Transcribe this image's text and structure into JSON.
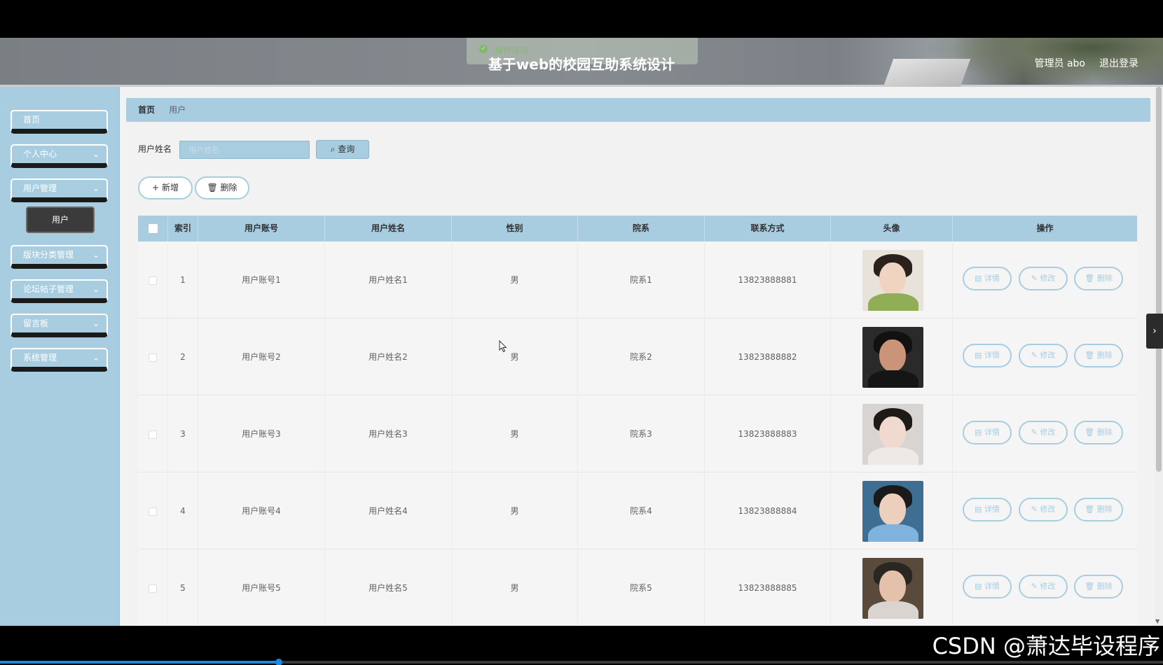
{
  "header": {
    "title": "基于web的校园互助系统设计",
    "toast": "操作成功",
    "user": "管理员 abo",
    "logout": "退出登录"
  },
  "sidebar": {
    "items": [
      {
        "label": "首页",
        "has_arrow": false
      },
      {
        "label": "个人中心",
        "has_arrow": true
      },
      {
        "label": "用户管理",
        "has_arrow": true
      },
      {
        "label": "版块分类管理",
        "has_arrow": true
      },
      {
        "label": "论坛帖子管理",
        "has_arrow": true
      },
      {
        "label": "留言板",
        "has_arrow": true
      },
      {
        "label": "系统管理",
        "has_arrow": true
      }
    ],
    "active_sub": "用户"
  },
  "breadcrumb": {
    "home": "首页",
    "current": "用户"
  },
  "search": {
    "label": "用户姓名",
    "placeholder": "用户姓名",
    "value": "",
    "button": "查询"
  },
  "actions": {
    "add": "新增",
    "delete": "删除"
  },
  "table": {
    "columns": [
      "索引",
      "用户账号",
      "用户姓名",
      "性别",
      "院系",
      "联系方式",
      "头像",
      "操作"
    ],
    "rows": [
      {
        "index": "1",
        "account": "用户账号1",
        "name": "用户姓名1",
        "gender": "男",
        "dept": "院系1",
        "phone": "13823888881"
      },
      {
        "index": "2",
        "account": "用户账号2",
        "name": "用户姓名2",
        "gender": "男",
        "dept": "院系2",
        "phone": "13823888882"
      },
      {
        "index": "3",
        "account": "用户账号3",
        "name": "用户姓名3",
        "gender": "男",
        "dept": "院系3",
        "phone": "13823888883"
      },
      {
        "index": "4",
        "account": "用户账号4",
        "name": "用户姓名4",
        "gender": "男",
        "dept": "院系4",
        "phone": "13823888884"
      },
      {
        "index": "5",
        "account": "用户账号5",
        "name": "用户姓名5",
        "gender": "男",
        "dept": "院系5",
        "phone": "13823888885"
      }
    ],
    "row_buttons": {
      "detail": "详情",
      "edit": "修改",
      "delete": "删除"
    }
  },
  "watermark": "CSDN @萧达毕设程序",
  "video_progress": 0.24,
  "colors": {
    "accent": "#a8cde1",
    "menu_active": "#3b3b3b",
    "success": "#67c23a"
  }
}
